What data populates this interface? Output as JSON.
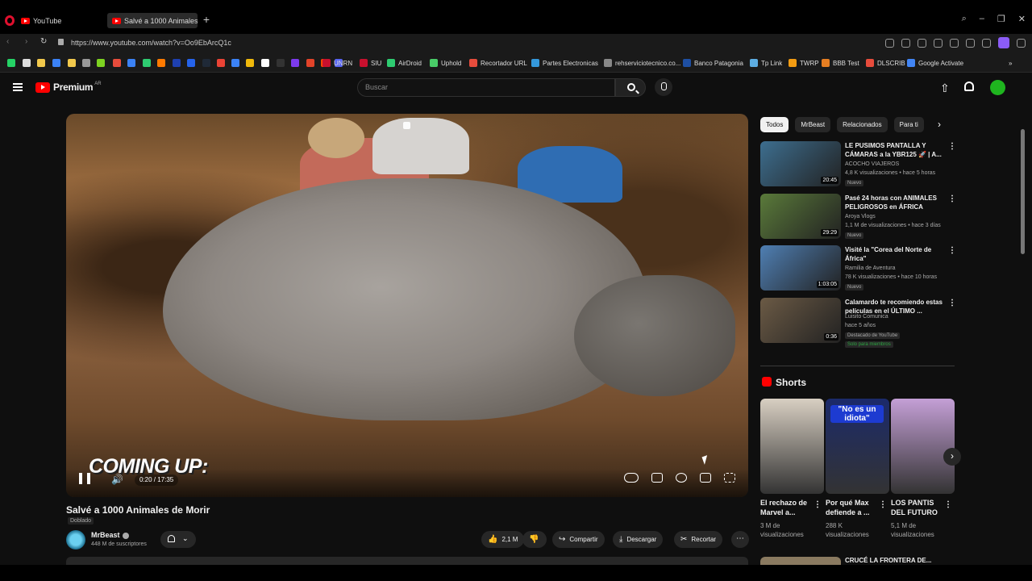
{
  "browser": {
    "tabs": [
      {
        "label": "YouTube"
      },
      {
        "label": "Salvé a 1000 Animales"
      }
    ],
    "url": "https://www.youtube.com/watch?v=Oo9EbArcQ1c",
    "bookmarks": [
      {
        "label": "UNRN",
        "color": "#c8102e"
      },
      {
        "label": "SIU",
        "color": "#c8102e"
      },
      {
        "label": "AirDroid",
        "color": "#2ecc71"
      },
      {
        "label": "Uphold",
        "color": "#49cc68"
      },
      {
        "label": "Recortador URL",
        "color": "#e74c3c"
      },
      {
        "label": "Partes Electronicas",
        "color": "#3498db"
      },
      {
        "label": "rehserviciotecnico.co...",
        "color": "#888888"
      },
      {
        "label": "Banco Patagonia",
        "color": "#1e4fa3"
      },
      {
        "label": "Tp Link",
        "color": "#5dade2"
      },
      {
        "label": "TWRP",
        "color": "#f39c12"
      },
      {
        "label": "BBB Test",
        "color": "#e67e22"
      },
      {
        "label": "DLSCRIB",
        "color": "#e74c3c"
      },
      {
        "label": "Google Activate",
        "color": "#4285f4"
      }
    ]
  },
  "yt": {
    "logo": "Premium",
    "logo_sup": "AR",
    "search_placeholder": "Buscar"
  },
  "video": {
    "title": "Salvé a 1000 Animales de Morir",
    "dubbed": "Doblado",
    "overlay_text": "COMING UP:",
    "time": "0:20 / 17:35",
    "channel": "MrBeast",
    "subscribers": "448 M de suscriptores",
    "likes": "2,1 M",
    "share": "Compartir",
    "download": "Descargar",
    "clip": "Recortar"
  },
  "sidebar": {
    "chips": [
      {
        "label": "Todos",
        "active": true
      },
      {
        "label": "MrBeast"
      },
      {
        "label": "Relacionados"
      },
      {
        "label": "Para ti"
      }
    ],
    "recommendations": [
      {
        "title": "LE PUSIMOS PANTALLA Y CÁMARAS a la YBR125 🚀 | A...",
        "channel": "ACOCHO VIAJEROS",
        "meta": "4,8 K visualizaciones • hace 5 horas",
        "badge": "Nuevo",
        "duration": "20:45",
        "thumb": "#3d6e8f"
      },
      {
        "title": "Pasé 24 horas con ANIMALES PELIGROSOS en ÁFRICA",
        "channel": "Aroya Vlogs",
        "meta": "1,1 M de visualizaciones • hace 3 días",
        "badge": "Nuevo",
        "duration": "29:29",
        "thumb": "#5a7a3a"
      },
      {
        "title": "Visité la \"Corea del Norte de África\"",
        "channel": "Ramilia de Aventura",
        "meta": "78 K visualizaciones • hace 10 horas",
        "badge": "Nuevo",
        "duration": "1:03:05",
        "thumb": "#4f7fb3"
      },
      {
        "title": "Calamardo te recomiendo estas películas en el ÚLTIMO ...",
        "channel": "Luisito Comunica",
        "meta": "hace 5 años",
        "badge": "Destacado de YouTube",
        "badge2": "Solo para miembros",
        "duration": "0:36",
        "thumb": "#6b5a45"
      }
    ],
    "shorts_title": "Shorts",
    "shorts": [
      {
        "title": "El rechazo de Marvel a...",
        "views": "3 M de visualizaciones",
        "thumb": "#d8cfc2"
      },
      {
        "title": "Por qué Max defiende a ...",
        "views": "288 K visualizaciones",
        "thumb": "#1b2a6b",
        "caption": "\"No es un idiota\""
      },
      {
        "title": "LOS PANTIS DEL FUTURO",
        "views": "5,1 M de visualizaciones",
        "thumb": "#c49fd6"
      }
    ],
    "last_rec_title": "CRUCÉ LA FRONTERA DE..."
  }
}
